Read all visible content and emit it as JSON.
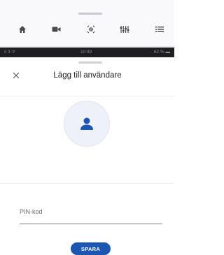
{
  "status_bar": {
    "signal": "ıl 3 ᯤ",
    "time": "10:49",
    "battery": "62 % ▬"
  },
  "top_nav": {
    "icons": [
      "home-icon",
      "camera-icon",
      "sensor-icon",
      "equalizer-icon",
      "list-icon"
    ]
  },
  "modal": {
    "title": "Lägg till användare",
    "close_icon": "close-icon",
    "avatar_icon": "person-icon",
    "pin_label": "PIN-kod",
    "save_label": "SPARA"
  },
  "colors": {
    "accent": "#1d56b0",
    "icon_dark": "#4a4a52",
    "avatar_bg": "#eef2f8"
  }
}
